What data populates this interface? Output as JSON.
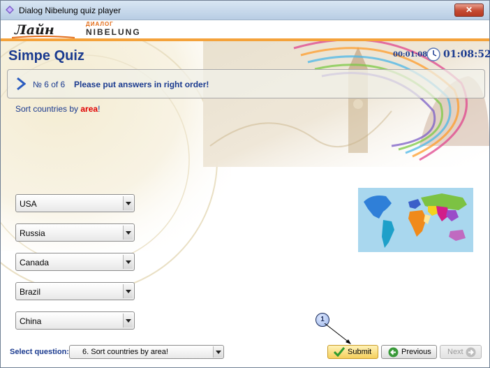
{
  "window": {
    "title": "Dialog Nibelung quiz player",
    "close_label": "✕"
  },
  "header": {
    "logo_left": "Лайн",
    "logo_right_top": "ДИАЛОГ",
    "logo_right_bottom": "NIBELUNG"
  },
  "quiz": {
    "title": "Simpe Quiz",
    "timer_elapsed": "00:01:08",
    "timer_total": "01:08:52",
    "question_number": "№ 6  of 6",
    "question_text": "Please put answers in right order!",
    "instruction_prefix": "Sort countries by ",
    "instruction_keyword": "area",
    "instruction_suffix": "!"
  },
  "answers": [
    {
      "value": "USA"
    },
    {
      "value": "Russia"
    },
    {
      "value": "Canada"
    },
    {
      "value": "Brazil"
    },
    {
      "value": "China"
    }
  ],
  "footer": {
    "select_label": "Select question:",
    "select_value": "6. Sort countries by area!",
    "submit_label": "Submit",
    "previous_label": "Previous",
    "next_label": "Next",
    "callout_number": "1"
  },
  "colors": {
    "accent": "#1a3a8f",
    "orange_bar": "#f4a23a",
    "highlight": "#e00000"
  }
}
